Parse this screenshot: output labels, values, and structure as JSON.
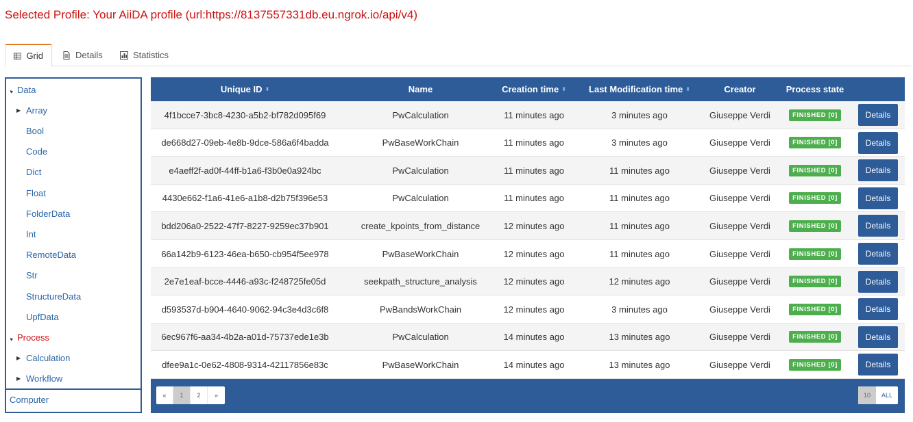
{
  "profile": {
    "title": "Selected Profile: Your AiiDA profile (url:https://8137557331db.eu.ngrok.io/api/v4)"
  },
  "tabs": [
    {
      "label": "Grid",
      "icon": "table-icon",
      "active": true
    },
    {
      "label": "Details",
      "icon": "document-icon",
      "active": false
    },
    {
      "label": "Statistics",
      "icon": "bar-chart-icon",
      "active": false
    }
  ],
  "sidebar": {
    "items": [
      {
        "label": "Data",
        "caret": "▲",
        "level": 0
      },
      {
        "label": "Array",
        "caret": "▶",
        "level": 1
      },
      {
        "label": "Bool",
        "caret": "",
        "level": 1
      },
      {
        "label": "Code",
        "caret": "",
        "level": 1
      },
      {
        "label": "Dict",
        "caret": "",
        "level": 1
      },
      {
        "label": "Float",
        "caret": "",
        "level": 1
      },
      {
        "label": "FolderData",
        "caret": "",
        "level": 1
      },
      {
        "label": "Int",
        "caret": "",
        "level": 1
      },
      {
        "label": "RemoteData",
        "caret": "",
        "level": 1
      },
      {
        "label": "Str",
        "caret": "",
        "level": 1
      },
      {
        "label": "StructureData",
        "caret": "",
        "level": 1
      },
      {
        "label": "UpfData",
        "caret": "",
        "level": 1
      },
      {
        "label": "Process",
        "caret": "▲",
        "level": 0,
        "active": true
      },
      {
        "label": "Calculation",
        "caret": "▶",
        "level": 1
      },
      {
        "label": "Workflow",
        "caret": "▶",
        "level": 1
      }
    ],
    "computer_label": "Computer"
  },
  "table": {
    "headers": {
      "uuid": "Unique ID",
      "name": "Name",
      "ctime": "Creation time",
      "mtime": "Last Modification time",
      "creator": "Creator",
      "state": "Process state"
    },
    "sort_glyph": "⬍",
    "details_label": "Details",
    "rows": [
      {
        "uuid": "4f1bcce7-3bc8-4230-a5b2-bf782d095f69",
        "name": "PwCalculation",
        "ctime": "11 minutes ago",
        "mtime": "3 minutes ago",
        "creator": "Giuseppe Verdi",
        "state": "FINISHED [0]"
      },
      {
        "uuid": "de668d27-09eb-4e8b-9dce-586a6f4badda",
        "name": "PwBaseWorkChain",
        "ctime": "11 minutes ago",
        "mtime": "3 minutes ago",
        "creator": "Giuseppe Verdi",
        "state": "FINISHED [0]"
      },
      {
        "uuid": "e4aeff2f-ad0f-44ff-b1a6-f3b0e0a924bc",
        "name": "PwCalculation",
        "ctime": "11 minutes ago",
        "mtime": "11 minutes ago",
        "creator": "Giuseppe Verdi",
        "state": "FINISHED [0]"
      },
      {
        "uuid": "4430e662-f1a6-41e6-a1b8-d2b75f396e53",
        "name": "PwCalculation",
        "ctime": "11 minutes ago",
        "mtime": "11 minutes ago",
        "creator": "Giuseppe Verdi",
        "state": "FINISHED [0]"
      },
      {
        "uuid": "bdd206a0-2522-47f7-8227-9259ec37b901",
        "name": "create_kpoints_from_distance",
        "ctime": "12 minutes ago",
        "mtime": "11 minutes ago",
        "creator": "Giuseppe Verdi",
        "state": "FINISHED [0]"
      },
      {
        "uuid": "66a142b9-6123-46ea-b650-cb954f5ee978",
        "name": "PwBaseWorkChain",
        "ctime": "12 minutes ago",
        "mtime": "11 minutes ago",
        "creator": "Giuseppe Verdi",
        "state": "FINISHED [0]"
      },
      {
        "uuid": "2e7e1eaf-bcce-4446-a93c-f248725fe05d",
        "name": "seekpath_structure_analysis",
        "ctime": "12 minutes ago",
        "mtime": "12 minutes ago",
        "creator": "Giuseppe Verdi",
        "state": "FINISHED [0]"
      },
      {
        "uuid": "d593537d-b904-4640-9062-94c3e4d3c6f8",
        "name": "PwBandsWorkChain",
        "ctime": "12 minutes ago",
        "mtime": "3 minutes ago",
        "creator": "Giuseppe Verdi",
        "state": "FINISHED [0]"
      },
      {
        "uuid": "6ec967f6-aa34-4b2a-a01d-75737ede1e3b",
        "name": "PwCalculation",
        "ctime": "14 minutes ago",
        "mtime": "13 minutes ago",
        "creator": "Giuseppe Verdi",
        "state": "FINISHED [0]"
      },
      {
        "uuid": "dfee9a1c-0e62-4808-9314-42117856e83c",
        "name": "PwBaseWorkChain",
        "ctime": "14 minutes ago",
        "mtime": "13 minutes ago",
        "creator": "Giuseppe Verdi",
        "state": "FINISHED [0]"
      }
    ]
  },
  "pagination": {
    "pages": [
      "«",
      "1",
      "2",
      "»"
    ],
    "active_page": "1",
    "page_sizes": [
      "10",
      "ALL"
    ],
    "active_size": "10"
  },
  "colors": {
    "header_blue": "#2d5c99",
    "title_red": "#cc1111",
    "badge_green": "#4cae4c",
    "tab_accent": "#e07b2a"
  }
}
